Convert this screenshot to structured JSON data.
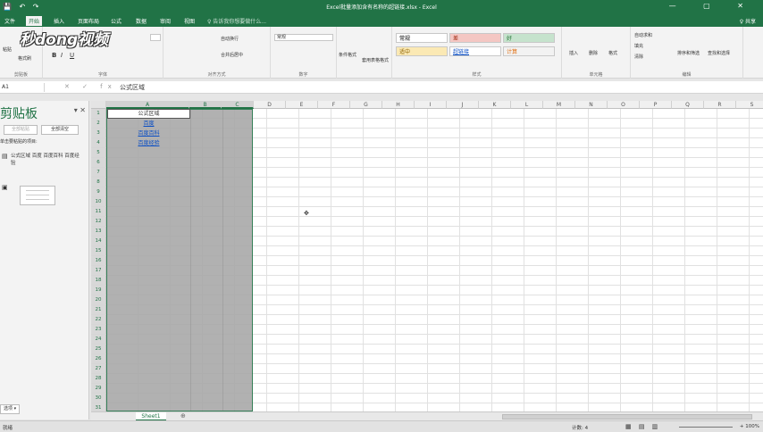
{
  "titlebar": {
    "quickaccess": "💾 ↶ ↷",
    "title": "Excel批量添加含有名称的超链接.xlsx - Excel",
    "win": "— ▢ ✕"
  },
  "tabs": [
    {
      "label": "文件"
    },
    {
      "label": "开始"
    },
    {
      "label": "插入"
    },
    {
      "label": "页面布局"
    },
    {
      "label": "公式"
    },
    {
      "label": "数据"
    },
    {
      "label": "审阅"
    },
    {
      "label": "视图"
    }
  ],
  "tellme": "♀ 告诉我你想要做什么...",
  "share": "♀ 共享",
  "logo": "秒dong视频",
  "ribbon": {
    "groups": [
      "剪贴板",
      "字体",
      "对齐方式",
      "数字",
      "",
      "样式",
      "单元格",
      "编辑"
    ],
    "font_b": "B",
    "font_i": "I",
    "font_u": "U",
    "wrap": "自动换行",
    "merge": "合并后居中",
    "number_format": "常规",
    "format_painter": "格式刷",
    "paste": "粘贴",
    "cond_format": "条件格式",
    "table_format": "套用表格格式",
    "styles": [
      {
        "label": "常规",
        "bg": "#ffffff",
        "color": "#000000"
      },
      {
        "label": "差",
        "bg": "#f4c7c3",
        "color": "#9c2006"
      },
      {
        "label": "好",
        "bg": "#c6e3cd",
        "color": "#1e6e2f"
      },
      {
        "label": "适中",
        "bg": "#fbe9b4",
        "color": "#8c6100"
      },
      {
        "label": "超链接",
        "bg": "#ffffff",
        "color": "#0a4ec4"
      },
      {
        "label": "计算",
        "bg": "#f2f2f2",
        "color": "#e07014"
      }
    ],
    "insert": "插入",
    "delete": "删除",
    "format": "格式",
    "autosum": "自动求和",
    "fill": "填充",
    "clear": "清除",
    "sort": "排序和筛选",
    "find": "查找和选择"
  },
  "formula_bar": {
    "namebox": "A1",
    "fx": "✕ ✓ fx",
    "content": "公式区域"
  },
  "clipboard": {
    "title": "剪贴板",
    "paste_all": "全部粘贴",
    "clear_all": "全部清空",
    "hint": "单击要粘贴的项目:",
    "item1": "公式区域 百度 百度百科 百度经验",
    "options": "选项 ▾"
  },
  "columns": [
    "A",
    "B",
    "C",
    "D",
    "E",
    "F",
    "G",
    "H",
    "I",
    "J",
    "K",
    "L",
    "M",
    "N",
    "O",
    "P",
    "Q",
    "R",
    "S"
  ],
  "rows": [
    "1",
    "2",
    "3",
    "4",
    "5",
    "6",
    "7",
    "8",
    "9",
    "10",
    "11",
    "12",
    "13",
    "14",
    "15",
    "16",
    "17",
    "18",
    "19",
    "20",
    "21",
    "22",
    "23",
    "24",
    "25",
    "26",
    "27",
    "28",
    "29",
    "30",
    "31"
  ],
  "cells": {
    "A1": "公式区域",
    "A2": "百度",
    "A3": "百度百科",
    "A4": "百度经验"
  },
  "sheet": {
    "name": "Sheet1",
    "add": "⊕"
  },
  "status": {
    "ready": "就绪",
    "count": "计数: 4",
    "views": "▦ ▤ ▥",
    "zoom": "+ 100%"
  }
}
